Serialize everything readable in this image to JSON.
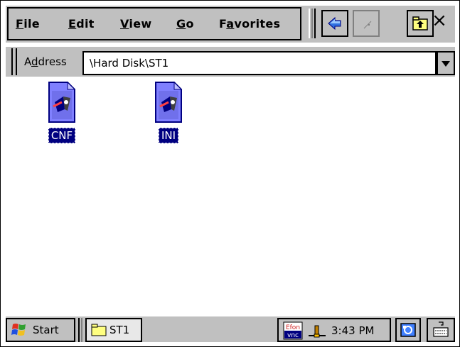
{
  "menu": {
    "file": {
      "mnemonic": "F",
      "rest": "ile"
    },
    "edit": {
      "mnemonic": "E",
      "rest": "dit"
    },
    "view": {
      "mnemonic": "V",
      "rest": "iew"
    },
    "go": {
      "mnemonic": "G",
      "rest": "o"
    },
    "favorites": {
      "pre": "F",
      "mnemonic": "a",
      "rest": "vorites"
    }
  },
  "toolbar": {
    "back_icon": "back-arrow-icon",
    "views_icon": "views-icon",
    "up_icon": "up-folder-icon",
    "close_label": "×"
  },
  "address": {
    "label_pre": "A",
    "label_mnemonic": "d",
    "label_rest": "dress",
    "value": "\\Hard Disk\\ST1"
  },
  "files": [
    {
      "name": "CNF",
      "icon": "config-file-icon"
    },
    {
      "name": "INI",
      "icon": "config-file-icon"
    }
  ],
  "taskbar": {
    "start_label": "Start",
    "task_label": "ST1",
    "tray_vnc_top": "Efon",
    "tray_vnc_bottom": "vnc",
    "time": "3:43 PM"
  },
  "colors": {
    "chrome": "#c0c0c0",
    "selection": "#000080",
    "window": "#ffffff"
  }
}
